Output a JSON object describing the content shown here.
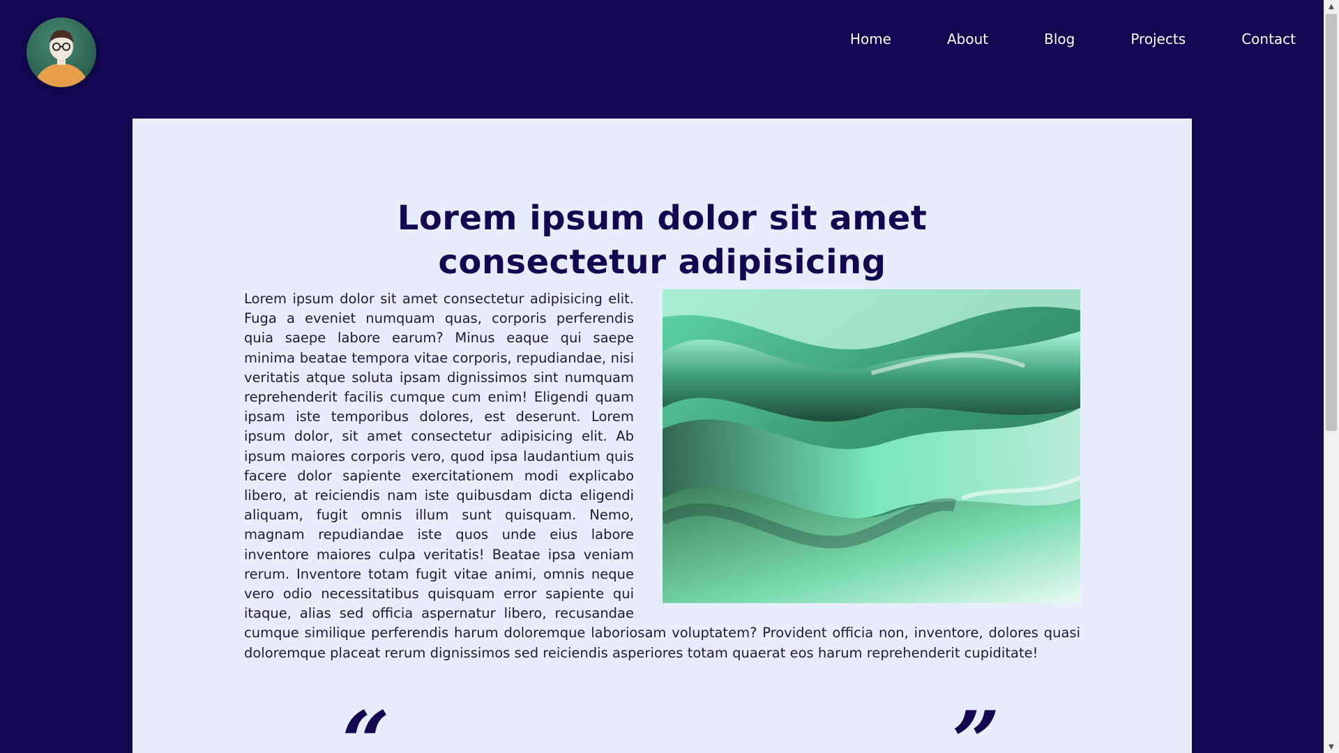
{
  "nav": {
    "items": [
      {
        "label": "Home"
      },
      {
        "label": "About"
      },
      {
        "label": "Blog"
      },
      {
        "label": "Projects"
      },
      {
        "label": "Contact"
      }
    ]
  },
  "article": {
    "title": "Lorem ipsum dolor sit amet consectetur adipisicing",
    "paragraph": "Lorem ipsum dolor sit amet consectetur adipisicing elit. Fuga a eveniet numquam quas, corporis perferendis quia saepe labore earum? Minus eaque qui saepe minima beatae tempora vitae corporis, repudiandae, nisi veritatis atque soluta ipsam dignissimos sint numquam reprehenderit facilis cumque cum enim! Eligendi quam ipsam iste temporibus dolores, est deserunt. Lorem ipsum dolor, sit amet consectetur adipisicing elit. Ab ipsum maiores corporis vero, quod ipsa laudantium quis facere dolor sapiente exercitationem modi explicabo libero, at reiciendis nam iste quibusdam dicta eligendi aliquam, fugit omnis illum sunt quisquam. Nemo, magnam repudiandae iste quos unde eius labore inventore maiores culpa veritatis! Beatae ipsa veniam rerum. Inventore totam fugit vitae animi, omnis neque vero odio necessitatibus quisquam error sapiente qui itaque, alias sed officia aspernatur libero, recusandae cumque similique perferendis harum doloremque laboriosam voluptatem? Provident officia non, inventore, dolores quasi doloremque placeat rerum dignissimos sed reiciendis asperiores totam quaerat eos harum reprehenderit cupiditate!",
    "quote_open": "“",
    "quote_close": "”"
  },
  "colors": {
    "background": "#130752",
    "content_panel": "#e8edfd",
    "title": "#130752",
    "nav_text": "#ffffff"
  },
  "icons": {
    "avatar": "avatar-illustration",
    "hero_image": "green-waves-image"
  }
}
